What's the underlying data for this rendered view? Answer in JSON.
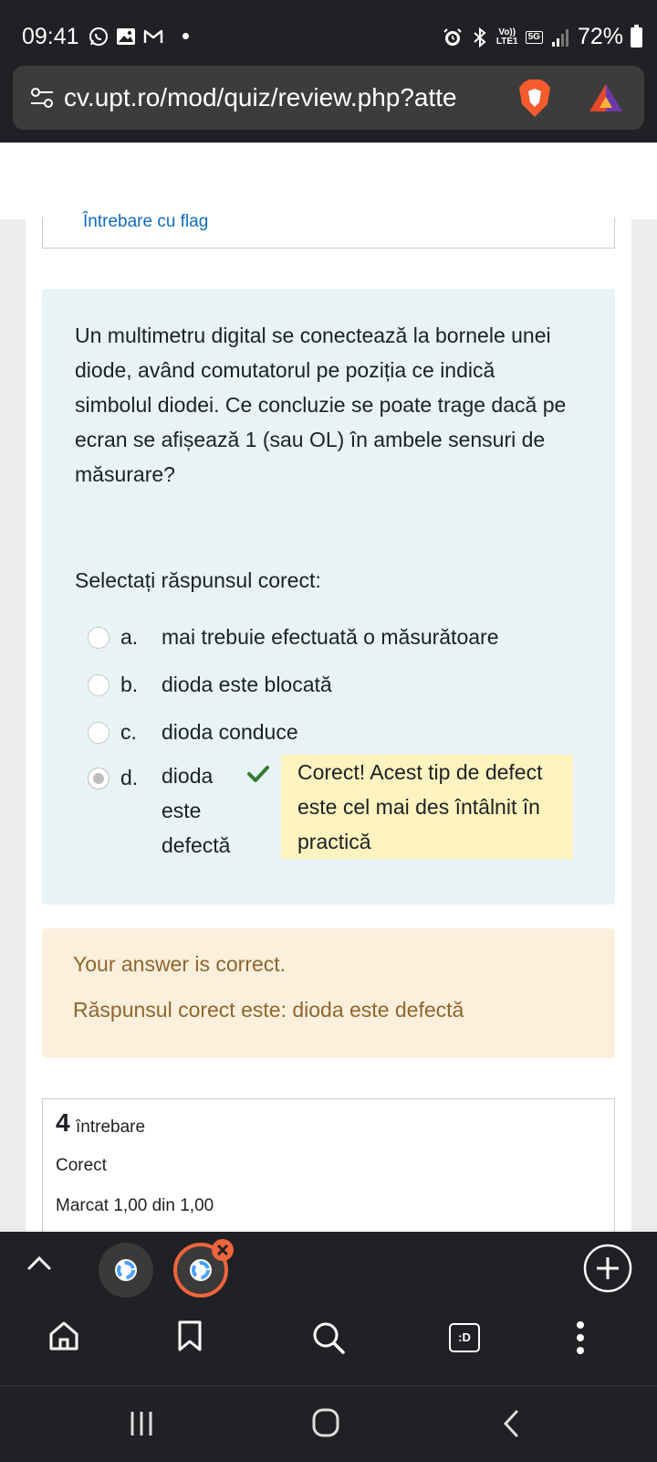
{
  "status_bar": {
    "time": "09:41",
    "network_top": "Vo))",
    "network_bottom": "LTE1",
    "network_5g": "5G",
    "battery": "72%"
  },
  "browser": {
    "url": "cv.upt.ro/mod/quiz/review.php?atte"
  },
  "quiz": {
    "flag_label": "Întrebare cu flag",
    "question": "Un multimetru digital se conectează la bornele unei diode, având comutatorul pe poziția ce indică simbolul diodei. Ce concluzie se poate trage dacă pe ecran se afișează 1 (sau OL) în ambele sensuri de măsurare?",
    "prompt": "Selectați răspunsul corect:",
    "options": [
      {
        "letter": "a.",
        "text": "mai trebuie efectuată o măsurătoare"
      },
      {
        "letter": "b.",
        "text": "dioda este blocată"
      },
      {
        "letter": "c.",
        "text": "dioda conduce"
      },
      {
        "letter": "d.",
        "text": "dioda este defectă",
        "selected": true
      }
    ],
    "option_feedback": "Corect! Acest tip de defect este cel mai des întâlnit în practică",
    "outcome_line1": "Your answer is correct.",
    "outcome_line2": "Răspunsul corect este: dioda este defectă",
    "next_question": {
      "number": "4",
      "word": "întrebare",
      "status": "Corect",
      "mark": "Marcat 1,00 din 1,00"
    }
  },
  "colors": {
    "question_bg": "#e7f3f5",
    "feedback_bg": "#fff3bf",
    "outcome_bg": "#fcefdc",
    "outcome_text": "#8e662e",
    "check": "#357a32",
    "tab_accent": "#f0653c"
  },
  "toolbar": {
    "tabs_label": ":D"
  }
}
